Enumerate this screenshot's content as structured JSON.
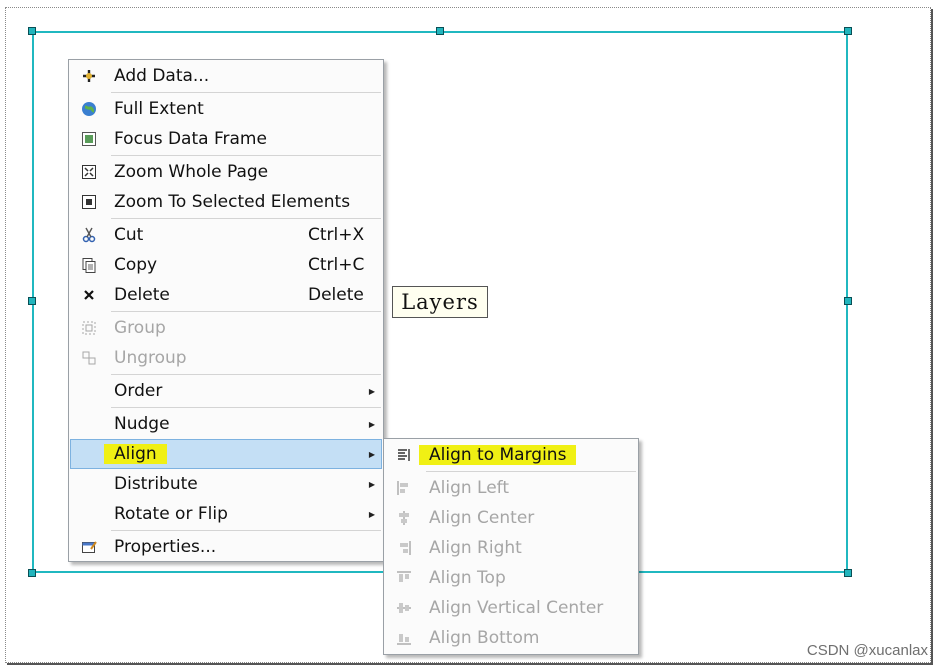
{
  "canvas": {
    "layers_label": "Layers",
    "frame_color": "#20b8c0"
  },
  "context_menu": {
    "items": [
      {
        "label": "Add Data...",
        "icon": "add-data-icon",
        "enabled": true
      },
      {
        "label": "Full Extent",
        "icon": "globe-icon",
        "enabled": true
      },
      {
        "label": "Focus Data Frame",
        "icon": "focus-data-frame-icon",
        "enabled": true
      },
      {
        "label": "Zoom Whole Page",
        "icon": "zoom-whole-page-icon",
        "enabled": true
      },
      {
        "label": "Zoom To Selected Elements",
        "icon": "zoom-selected-icon",
        "enabled": true
      },
      {
        "label": "Cut",
        "shortcut": "Ctrl+X",
        "icon": "scissors-icon",
        "enabled": true
      },
      {
        "label": "Copy",
        "shortcut": "Ctrl+C",
        "icon": "copy-icon",
        "enabled": true
      },
      {
        "label": "Delete",
        "shortcut": "Delete",
        "icon": "delete-icon",
        "enabled": true
      },
      {
        "label": "Group",
        "icon": "group-icon",
        "enabled": false
      },
      {
        "label": "Ungroup",
        "icon": "ungroup-icon",
        "enabled": false
      },
      {
        "label": "Order",
        "submenu": true,
        "enabled": true
      },
      {
        "label": "Nudge",
        "submenu": true,
        "enabled": true
      },
      {
        "label": "Align",
        "submenu": true,
        "enabled": true,
        "selected": true
      },
      {
        "label": "Distribute",
        "submenu": true,
        "enabled": true
      },
      {
        "label": "Rotate or Flip",
        "submenu": true,
        "enabled": true
      },
      {
        "label": "Properties...",
        "icon": "properties-icon",
        "enabled": true
      }
    ]
  },
  "align_submenu": {
    "items": [
      {
        "label": "Align to Margins",
        "icon": "align-to-margins-icon",
        "enabled": true,
        "highlighted": true
      },
      {
        "label": "Align Left",
        "icon": "align-left-icon",
        "enabled": false
      },
      {
        "label": "Align Center",
        "icon": "align-center-icon",
        "enabled": false
      },
      {
        "label": "Align Right",
        "icon": "align-right-icon",
        "enabled": false
      },
      {
        "label": "Align Top",
        "icon": "align-top-icon",
        "enabled": false
      },
      {
        "label": "Align Vertical Center",
        "icon": "align-vertical-center-icon",
        "enabled": false
      },
      {
        "label": "Align Bottom",
        "icon": "align-bottom-icon",
        "enabled": false
      }
    ]
  },
  "watermark": "CSDN @xucanlax",
  "colors": {
    "highlight_yellow": "#f0f014",
    "selection_blue": "#c4dff5"
  }
}
